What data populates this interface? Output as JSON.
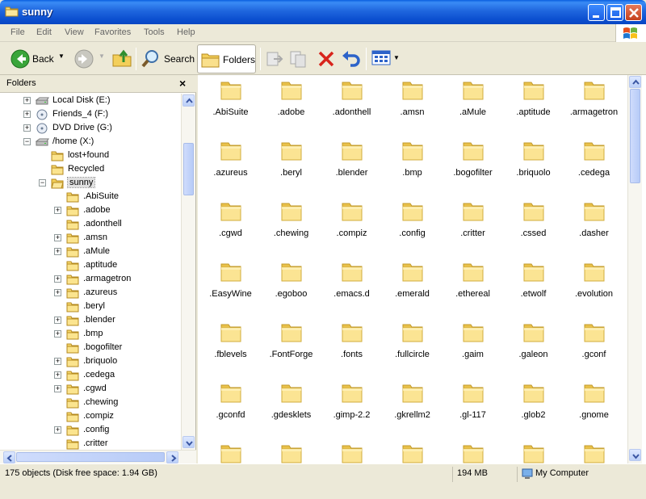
{
  "window": {
    "title": "sunny"
  },
  "menu": [
    "File",
    "Edit",
    "View",
    "Favorites",
    "Tools",
    "Help"
  ],
  "toolbar": {
    "back_label": "Back",
    "search_label": "Search",
    "folders_label": "Folders"
  },
  "folders_pane": {
    "title": "Folders",
    "close_label": "×",
    "items": [
      {
        "label": "Local Disk (E:)",
        "indent": 0,
        "expander": "+",
        "icon": "drive-icon"
      },
      {
        "label": "Friends_4 (F:)",
        "indent": 0,
        "expander": "+",
        "icon": "cd-drive-icon"
      },
      {
        "label": "DVD Drive (G:)",
        "indent": 0,
        "expander": "+",
        "icon": "dvd-drive-icon"
      },
      {
        "label": "/home (X:)",
        "indent": 0,
        "expander": "−",
        "icon": "network-drive-icon"
      },
      {
        "label": "lost+found",
        "indent": 1,
        "expander": "",
        "icon": "folder-icon"
      },
      {
        "label": "Recycled",
        "indent": 1,
        "expander": "",
        "icon": "folder-icon"
      },
      {
        "label": "sunny",
        "indent": 1,
        "expander": "−",
        "icon": "open-folder-icon",
        "selected": true
      },
      {
        "label": ".AbiSuite",
        "indent": 2,
        "expander": "",
        "icon": "folder-icon"
      },
      {
        "label": ".adobe",
        "indent": 2,
        "expander": "+",
        "icon": "folder-icon"
      },
      {
        "label": ".adonthell",
        "indent": 2,
        "expander": "",
        "icon": "folder-icon"
      },
      {
        "label": ".amsn",
        "indent": 2,
        "expander": "+",
        "icon": "folder-icon"
      },
      {
        "label": ".aMule",
        "indent": 2,
        "expander": "+",
        "icon": "folder-icon"
      },
      {
        "label": ".aptitude",
        "indent": 2,
        "expander": "",
        "icon": "folder-icon"
      },
      {
        "label": ".armagetron",
        "indent": 2,
        "expander": "+",
        "icon": "folder-icon"
      },
      {
        "label": ".azureus",
        "indent": 2,
        "expander": "+",
        "icon": "folder-icon"
      },
      {
        "label": ".beryl",
        "indent": 2,
        "expander": "",
        "icon": "folder-icon"
      },
      {
        "label": ".blender",
        "indent": 2,
        "expander": "+",
        "icon": "folder-icon"
      },
      {
        "label": ".bmp",
        "indent": 2,
        "expander": "+",
        "icon": "folder-icon"
      },
      {
        "label": ".bogofilter",
        "indent": 2,
        "expander": "",
        "icon": "folder-icon"
      },
      {
        "label": ".briquolo",
        "indent": 2,
        "expander": "+",
        "icon": "folder-icon"
      },
      {
        "label": ".cedega",
        "indent": 2,
        "expander": "+",
        "icon": "folder-icon"
      },
      {
        "label": ".cgwd",
        "indent": 2,
        "expander": "+",
        "icon": "folder-icon"
      },
      {
        "label": ".chewing",
        "indent": 2,
        "expander": "",
        "icon": "folder-icon"
      },
      {
        "label": ".compiz",
        "indent": 2,
        "expander": "",
        "icon": "folder-icon"
      },
      {
        "label": ".config",
        "indent": 2,
        "expander": "+",
        "icon": "folder-icon"
      },
      {
        "label": ".critter",
        "indent": 2,
        "expander": "",
        "icon": "folder-icon"
      }
    ]
  },
  "content_items": [
    ".AbiSuite",
    ".adobe",
    ".adonthell",
    ".amsn",
    ".aMule",
    ".aptitude",
    ".armagetron",
    ".azureus",
    ".beryl",
    ".blender",
    ".bmp",
    ".bogofilter",
    ".briquolo",
    ".cedega",
    ".cgwd",
    ".chewing",
    ".compiz",
    ".config",
    ".critter",
    ".cssed",
    ".dasher",
    ".EasyWine",
    ".egoboo",
    ".emacs.d",
    ".emerald",
    ".ethereal",
    ".etwolf",
    ".evolution",
    ".fblevels",
    ".FontForge",
    ".fonts",
    ".fullcircle",
    ".gaim",
    ".galeon",
    ".gconf",
    ".gconfd",
    ".gdesklets",
    ".gimp-2.2",
    ".gkrellm2",
    ".gl-117",
    ".glob2",
    ".gnome",
    "",
    "",
    "",
    "",
    "",
    "",
    ""
  ],
  "statusbar": {
    "objects": "175 objects (Disk free space: 1.94 GB)",
    "size": "194 MB",
    "location": "My Computer"
  },
  "colors": {
    "titlebar": "#0a5fe0",
    "folder": "#f5d66b",
    "chrome": "#ece9d8"
  }
}
